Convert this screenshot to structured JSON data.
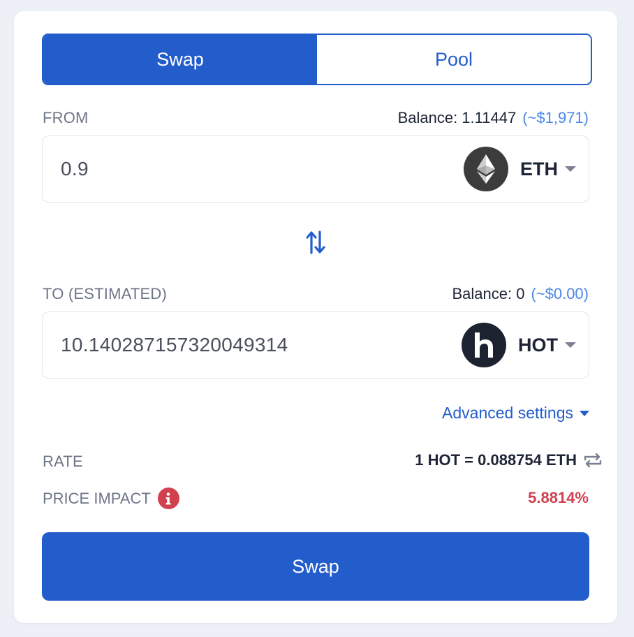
{
  "tabs": [
    {
      "label": "Swap",
      "active": true
    },
    {
      "label": "Pool",
      "active": false
    }
  ],
  "from": {
    "label": "FROM",
    "balance_label": "Balance: 1.11447",
    "balance_fiat": "(~$1,971)",
    "amount": "0.9",
    "token": {
      "symbol": "ETH",
      "icon": "ethereum-icon"
    }
  },
  "to": {
    "label": "TO (ESTIMATED)",
    "balance_label": "Balance: 0",
    "balance_fiat": "(~$0.00)",
    "amount": "10.140287157320049314",
    "token": {
      "symbol": "HOT",
      "icon": "holo-icon"
    }
  },
  "advanced_settings": "Advanced settings",
  "rate": {
    "label": "RATE",
    "value": "1 HOT = 0.088754 ETH"
  },
  "price_impact": {
    "label": "PRICE IMPACT",
    "value": "5.8814%"
  },
  "swap_button": "Swap",
  "colors": {
    "primary": "#235dcb",
    "fiat": "#4a86e8",
    "danger": "#d0404f",
    "muted": "#6d7588"
  }
}
